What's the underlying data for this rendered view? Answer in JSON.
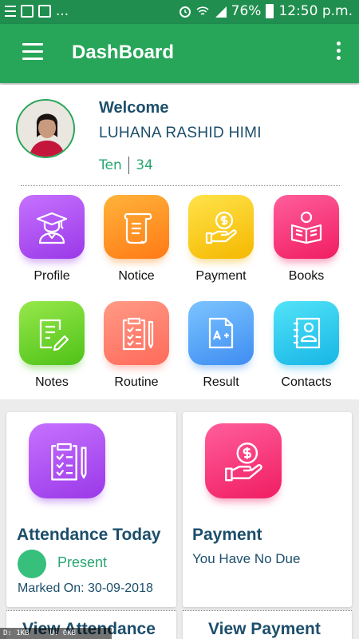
{
  "status_bar": {
    "left_text": "...",
    "battery": "76%",
    "time": "12:50 p.m."
  },
  "app_bar": {
    "title": "DashBoard"
  },
  "profile": {
    "welcome": "Welcome",
    "name": "LUHANA RASHID HIMI",
    "class": "Ten",
    "roll": "34"
  },
  "menu": {
    "items": [
      {
        "label": "Profile",
        "icon": "graduate-icon",
        "color": "#a94ff0"
      },
      {
        "label": "Notice",
        "icon": "scroll-icon",
        "color": "#ff8c1f"
      },
      {
        "label": "Payment",
        "icon": "coin-hand-icon",
        "color": "#fcd11a"
      },
      {
        "label": "Books",
        "icon": "reader-icon",
        "color": "#f8307a"
      },
      {
        "label": "Notes",
        "icon": "note-pen-icon",
        "color": "#66d123"
      },
      {
        "label": "Routine",
        "icon": "checklist-icon",
        "color": "#ff7a6a"
      },
      {
        "label": "Result",
        "icon": "grade-doc-icon",
        "color": "#4e9cf6"
      },
      {
        "label": "Contacts",
        "icon": "contact-book-icon",
        "color": "#22c2ec"
      }
    ]
  },
  "attendance": {
    "title": "Attendance Today",
    "status": "Present",
    "marked_on": "Marked On: 30-09-2018",
    "link": "View Attendance",
    "status_color": "#36c07b"
  },
  "payment": {
    "title": "Payment",
    "status": "You Have No Due",
    "link": "View Payment"
  },
  "overlay": {
    "down": "D: 1KB",
    "up": "U: 0KB"
  }
}
